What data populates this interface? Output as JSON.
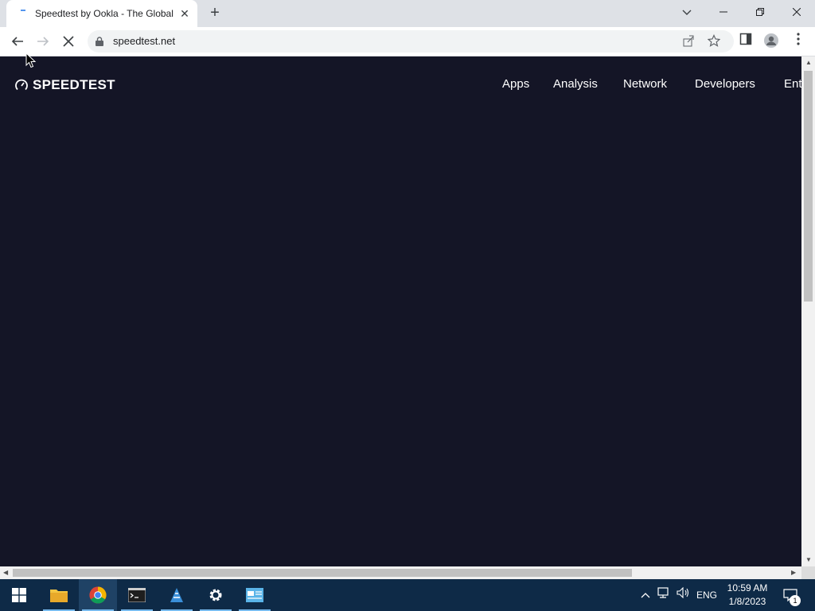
{
  "browser": {
    "tab": {
      "title": "Speedtest by Ookla - The Global Broadband Speed Test",
      "close_glyph": "✕"
    },
    "new_tab_glyph": "+",
    "window_controls": {
      "tab_search": "⌄",
      "minimize": "—",
      "restore": "❐",
      "close": "✕"
    },
    "nav": {
      "back": "←",
      "forward": "→",
      "stop": "✕"
    },
    "url": "speedtest.net"
  },
  "page": {
    "logo_text": "SPEEDTEST",
    "nav_links": [
      "Apps",
      "Analysis",
      "Network",
      "Developers",
      "Ent"
    ]
  },
  "taskbar": {
    "tray": {
      "language": "ENG",
      "time": "10:59 AM",
      "date": "1/8/2023",
      "notification_count": "1"
    },
    "apps": [
      "file-explorer",
      "chrome",
      "command-prompt",
      "network-app",
      "settings",
      "control-panel"
    ]
  },
  "colors": {
    "page_bg": "#141526",
    "taskbar_bg": "#0e2a47",
    "tab_strip_bg": "#dee1e6"
  }
}
